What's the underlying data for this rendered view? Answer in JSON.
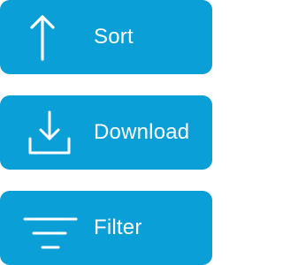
{
  "actions": [
    {
      "id": "sort",
      "label": "Sort",
      "icon": "arrow-up-icon"
    },
    {
      "id": "download",
      "label": "Download",
      "icon": "download-icon"
    },
    {
      "id": "filter",
      "label": "Filter",
      "icon": "filter-icon"
    }
  ],
  "colors": {
    "button_background": "#0a9fd6",
    "foreground": "#ffffff"
  }
}
